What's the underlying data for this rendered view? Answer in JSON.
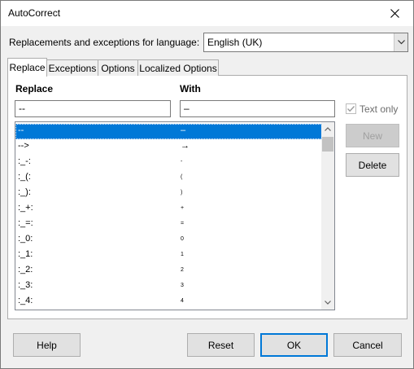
{
  "window": {
    "title": "AutoCorrect"
  },
  "language": {
    "label": "Replacements and exceptions for language:",
    "value": "English (UK)"
  },
  "tabs": [
    {
      "label": "Replace"
    },
    {
      "label": "Exceptions"
    },
    {
      "label": "Options"
    },
    {
      "label": "Localized Options"
    }
  ],
  "replace": {
    "col_replace": "Replace",
    "col_with": "With",
    "replace_value": "--",
    "with_value": "–",
    "text_only_label": "Text only",
    "text_only_checked": true,
    "rows": [
      {
        "replace": "--",
        "with": "–"
      },
      {
        "replace": "-->",
        "with": "→"
      },
      {
        "replace": ":_-:",
        "with": "-"
      },
      {
        "replace": ":_(:",
        "with": "("
      },
      {
        "replace": ":_):",
        "with": ")"
      },
      {
        "replace": ":_+:",
        "with": "+"
      },
      {
        "replace": ":_=:",
        "with": "="
      },
      {
        "replace": ":_0:",
        "with": "0"
      },
      {
        "replace": ":_1:",
        "with": "1"
      },
      {
        "replace": ":_2:",
        "with": "2"
      },
      {
        "replace": ":_3:",
        "with": "3"
      },
      {
        "replace": ":_4:",
        "with": "4"
      }
    ]
  },
  "buttons": {
    "new": "New",
    "delete": "Delete",
    "help": "Help",
    "reset": "Reset",
    "ok": "OK",
    "cancel": "Cancel"
  }
}
